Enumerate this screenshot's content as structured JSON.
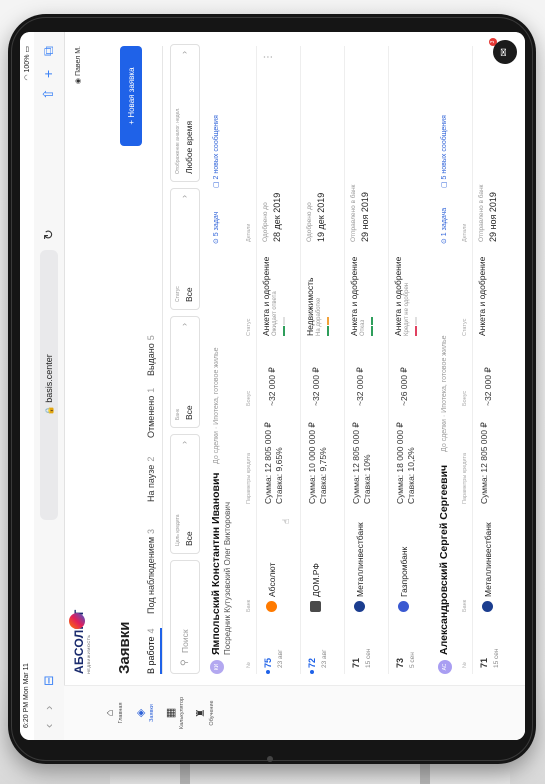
{
  "status_bar": {
    "time": "6:20 PM  Mon Mar 11",
    "battery": "100%"
  },
  "browser": {
    "url": "basis.center"
  },
  "sidebar": {
    "items": [
      {
        "label": "Главная",
        "icon": "home-icon"
      },
      {
        "label": "Заявки",
        "icon": "layers-icon"
      },
      {
        "label": "Калькулятор",
        "icon": "calculator-icon"
      },
      {
        "label": "Обучение",
        "icon": "graduation-cap-icon"
      }
    ]
  },
  "header": {
    "brand": "АБСОЛЮТ",
    "brand_sub": "НЕДВИЖИМОСТЬ",
    "user": "Павел М."
  },
  "page": {
    "title": "Заявки",
    "new_button": "+ Новая заявка"
  },
  "tabs": [
    {
      "label": "В работе",
      "count": "4"
    },
    {
      "label": "Под наблюдением",
      "count": "3"
    },
    {
      "label": "На паузе",
      "count": "2"
    },
    {
      "label": "Отменено",
      "count": "1"
    },
    {
      "label": "Выдано",
      "count": "5"
    }
  ],
  "filters": {
    "search_placeholder": "Поиск",
    "items": [
      {
        "label": "Цель кредита",
        "value": "Все"
      },
      {
        "label": "Банк",
        "value": "Все"
      },
      {
        "label": "Статус",
        "value": "Все"
      },
      {
        "label": "Отображение аналог. недел.",
        "value": "Любое время"
      }
    ]
  },
  "columns": {
    "num": "№",
    "bank": "Банк",
    "params": "Параметры кредита",
    "bonus": "Бонус",
    "status": "Статус",
    "details": "Детали"
  },
  "groups": [
    {
      "initials": "КИ",
      "client": "Ямпольский Константин Иванович",
      "deal": "До сделки · Ипотека, готовое жилье",
      "rep": "Посредник Кутузовский Олег Викторович",
      "tasks": "5 задач",
      "messages": "2 новых сообщения",
      "rows": [
        {
          "num": "75",
          "date": "23 авг",
          "bank": "Абсолют",
          "sum": "Сумма: 12 805 000 ₽",
          "rate": "Ставка: 9,65%",
          "bonus": "~32 000 ₽",
          "status": "Анкета и одобрение",
          "status_sub": "Ожидает ответа",
          "detail_sub": "Одобрено до",
          "detail_date": "28 дек 2019"
        },
        {
          "num": "72",
          "date": "23 авг",
          "bank": "ДОМ.РФ",
          "sum": "Сумма: 10 000 000 ₽",
          "rate": "Ставка: 9,75%",
          "bonus": "~32 000 ₽",
          "status": "Недвижимость",
          "status_sub": "На доработке",
          "detail_sub": "Одобрено до",
          "detail_date": "19 дек 2019"
        },
        {
          "num": "71",
          "date": "15 сен",
          "bank": "Металлинвестбанк",
          "sum": "Сумма: 12 805 000 ₽",
          "rate": "Ставка: 10%",
          "bonus": "~32 000 ₽",
          "status": "Анкета и одобрение",
          "status_sub": "Отказ",
          "detail_sub": "Отправлено в банк",
          "detail_date": "29 ноя 2019"
        },
        {
          "num": "73",
          "date": "5 сен",
          "bank": "Газпромбанк",
          "sum": "Сумма: 18 000 000 ₽",
          "rate": "Ставка: 10,2%",
          "bonus": "~26 000 ₽",
          "status": "Анкета и одобрение",
          "status_sub": "Кредит не одобрен",
          "detail_sub": "",
          "detail_date": ""
        }
      ]
    },
    {
      "initials": "АС",
      "client": "Александровский Сергей Сергеевич",
      "deal": "До сделки · Ипотека, готовое жилье",
      "tasks": "1 задача",
      "messages": "5 новых сообщения",
      "rows": [
        {
          "num": "71",
          "date": "15 сен",
          "bank": "Металлинвестбанк",
          "sum": "Сумма: 12 805 000 ₽",
          "rate": "",
          "bonus": "~32 000 ₽",
          "status": "Анкета и одобрение",
          "status_sub": "",
          "detail_sub": "Отправлено в банк",
          "detail_date": "29 ноя 2019"
        }
      ]
    }
  ],
  "colors": {
    "accent": "#1f62e8",
    "absolut": "#ff7a00",
    "domrf": "#4a4a4a",
    "metall": "#1b3d8f",
    "gazprom": "#3a59d1"
  }
}
